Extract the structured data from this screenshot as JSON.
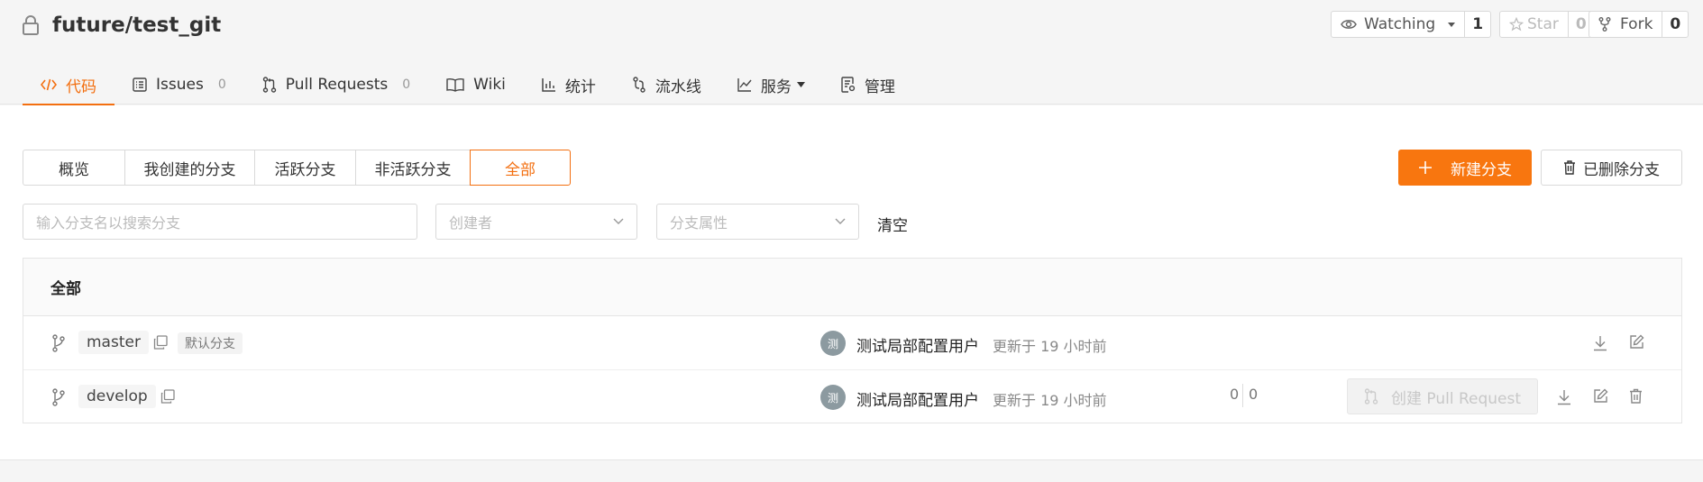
{
  "repo": {
    "name": "future/test_git",
    "watch_label": "Watching",
    "watch_count": "1",
    "star_label": "Star",
    "star_count": "0",
    "fork_label": "Fork",
    "fork_count": "0"
  },
  "nav": {
    "tabs": [
      {
        "label": "代码",
        "count": ""
      },
      {
        "label": "Issues",
        "count": "0"
      },
      {
        "label": "Pull Requests",
        "count": "0"
      },
      {
        "label": "Wiki",
        "count": ""
      },
      {
        "label": "统计",
        "count": ""
      },
      {
        "label": "流水线",
        "count": ""
      },
      {
        "label": "服务",
        "count": ""
      },
      {
        "label": "管理",
        "count": ""
      }
    ]
  },
  "filters": {
    "tabs": [
      "概览",
      "我创建的分支",
      "活跃分支",
      "非活跃分支",
      "全部"
    ],
    "active_index": 4,
    "new_branch": "新建分支",
    "deleted_branches": "已删除分支",
    "search_placeholder": "输入分支名以搜索分支",
    "creator_placeholder": "创建者",
    "attr_placeholder": "分支属性",
    "clear": "清空"
  },
  "table": {
    "header": "全部",
    "rows": [
      {
        "branch": "master",
        "tag": "默认分支",
        "avatar": "测",
        "user": "测试局部配置用户",
        "updated": "更新于 19 小时前"
      },
      {
        "branch": "develop",
        "avatar": "测",
        "user": "测试局部配置用户",
        "updated": "更新于 19 小时前",
        "behind": "0",
        "ahead": "0",
        "create_pr": "创建 Pull Request"
      }
    ]
  },
  "colors": {
    "accent": "#f36f10",
    "primary_button": "#f8760f"
  }
}
